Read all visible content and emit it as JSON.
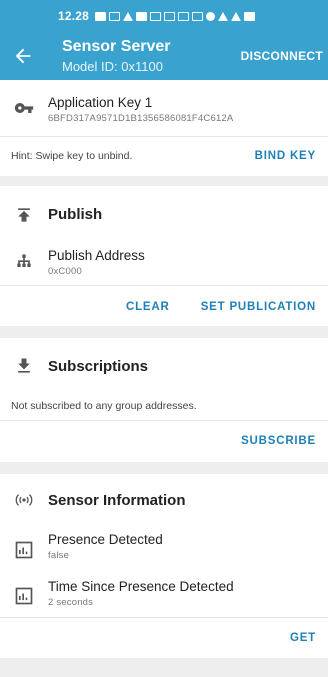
{
  "status_bar": {
    "time": "12.28"
  },
  "app_bar": {
    "title": "Sensor Server",
    "subtitle": "Model ID: 0x1100",
    "action": "DISCONNECT"
  },
  "app_key": {
    "title": "Application Key 1",
    "value": "6BFD317A9571D1B1356586081F4C612A",
    "hint": "Hint: Swipe key to unbind.",
    "bind_button": "BIND KEY"
  },
  "publish": {
    "title": "Publish",
    "address_label": "Publish Address",
    "address_value": "0xC000",
    "clear_button": "CLEAR",
    "set_button": "SET PUBLICATION"
  },
  "subscriptions": {
    "title": "Subscriptions",
    "empty_text": "Not subscribed to any group addresses.",
    "subscribe_button": "SUBSCRIBE"
  },
  "sensor": {
    "title": "Sensor Information",
    "items": [
      {
        "label": "Presence Detected",
        "value": "false"
      },
      {
        "label": "Time Since Presence Detected",
        "value": "2 seconds"
      }
    ],
    "get_button": "GET"
  }
}
